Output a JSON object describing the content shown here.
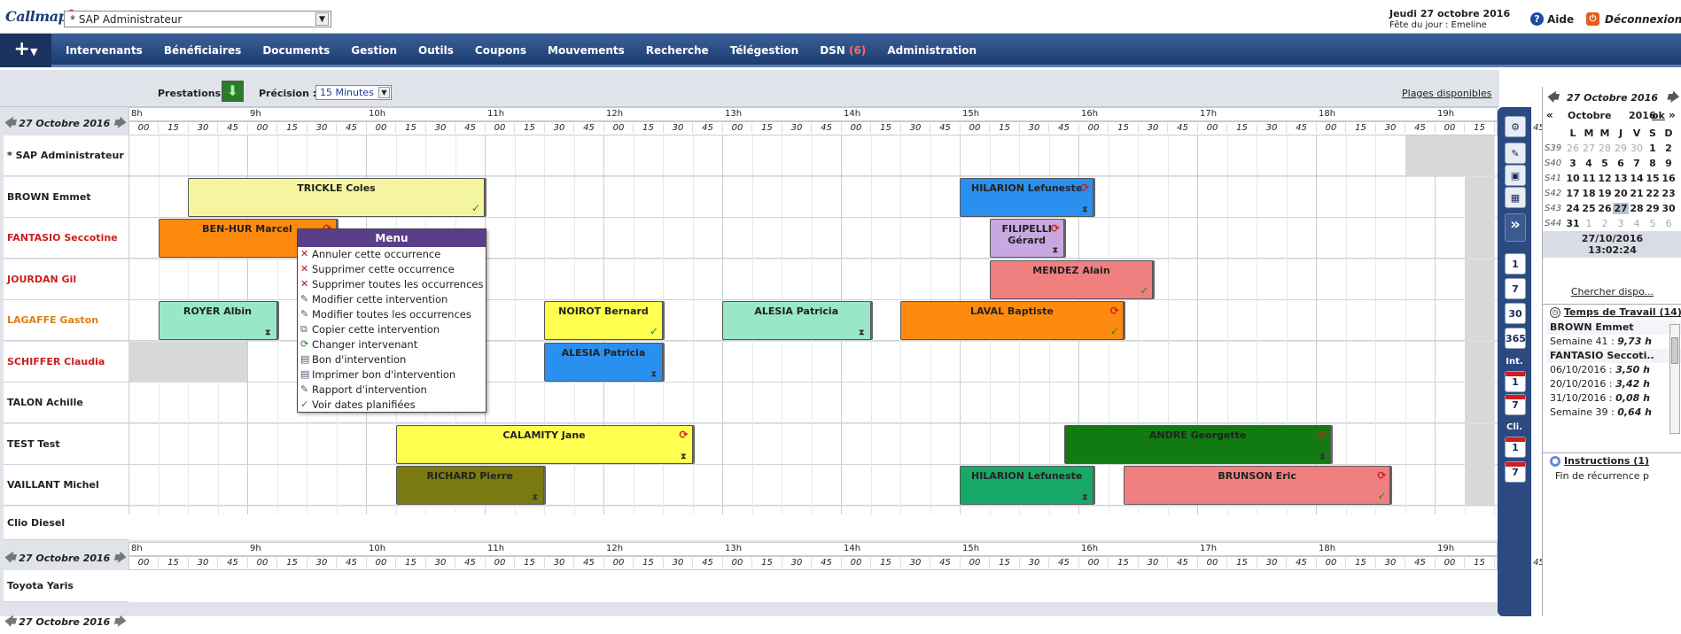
{
  "header": {
    "logo": "Callmap",
    "profile": "* SAP Administrateur",
    "date": "Jeudi 27 octobre 2016",
    "fete": "Fête du jour : Emeline",
    "help": "Aide",
    "logout": "Déconnexion"
  },
  "nav": {
    "items": [
      "Intervenants",
      "Bénéficiaires",
      "Documents",
      "Gestion",
      "Outils",
      "Coupons",
      "Mouvements",
      "Recherche",
      "Télégestion"
    ],
    "dsn_label": "DSN",
    "dsn_count": "(6)",
    "admin": "Administration"
  },
  "toolbar": {
    "prestations": "Prestations",
    "precision_label": "Précision :",
    "precision_value": "15 Minutes",
    "plages": "Plages disponibles"
  },
  "schedule": {
    "date": "27 Octobre 2016",
    "hours": [
      "8h",
      "9h",
      "10h",
      "11h",
      "12h",
      "13h",
      "14h",
      "15h",
      "16h",
      "17h",
      "18h",
      "19h"
    ],
    "minutes": [
      "00",
      "15",
      "30",
      "45"
    ],
    "last_hour_minutes": [
      "00",
      "15",
      "30",
      "45"
    ],
    "rows": [
      {
        "name": "* SAP Administrateur",
        "color": "#222"
      },
      {
        "name": "BROWN Emmet",
        "color": "#222"
      },
      {
        "name": "FANTASIO Seccotine",
        "color": "#d01d1d"
      },
      {
        "name": "JOURDAN Gil",
        "color": "#d01d1d"
      },
      {
        "name": "LAGAFFE Gaston",
        "color": "#e07d10"
      },
      {
        "name": "SCHIFFER Claudia",
        "color": "#d01d1d"
      },
      {
        "name": "TALON Achille",
        "color": "#222"
      },
      {
        "name": "TEST Test",
        "color": "#222"
      },
      {
        "name": "VAILLANT Michel",
        "color": "#222"
      }
    ],
    "extra_rows": [
      "Clio Diesel",
      "Toyota Yaris"
    ],
    "events": [
      {
        "row": 1,
        "label": "TRICKLE Coles",
        "start": 8.5,
        "end": 11,
        "bg": "#f5f5a0",
        "chk": true
      },
      {
        "row": 1,
        "label": "HILARION Lefuneste",
        "start": 15,
        "end": 16.13,
        "bg": "#2a90f0",
        "rec": true,
        "hg": true
      },
      {
        "row": 2,
        "label": "BEN-HUR Marcel",
        "start": 8.25,
        "end": 9.75,
        "bg": "#ff8a10",
        "rec": true
      },
      {
        "row": 2,
        "label": "FILIPELLI Gérard",
        "start": 15.25,
        "end": 15.88,
        "bg": "#c8a8e0",
        "rec": true,
        "hg": true
      },
      {
        "row": 3,
        "label": "MENDEZ Alain",
        "start": 15.25,
        "end": 16.63,
        "bg": "#f08080",
        "chk": true
      },
      {
        "row": 4,
        "label": "ROYER Albin",
        "start": 8.25,
        "end": 9.25,
        "bg": "#98e8c8",
        "hg": true
      },
      {
        "row": 4,
        "label": "NOIROT Bernard",
        "start": 11.5,
        "end": 12.5,
        "bg": "#ffff50",
        "chk": true
      },
      {
        "row": 4,
        "label": "ALESIA Patricia",
        "start": 13,
        "end": 14.25,
        "bg": "#98e8c8",
        "hg": true
      },
      {
        "row": 4,
        "label": "LAVAL Baptiste",
        "start": 14.5,
        "end": 16.38,
        "bg": "#ff8a10",
        "rec": true,
        "chk": true
      },
      {
        "row": 5,
        "label": "ALESIA Patricia",
        "start": 11.5,
        "end": 12.5,
        "bg": "#2a90f0",
        "hg": true
      },
      {
        "row": 7,
        "label": "CALAMITY Jane",
        "start": 10.25,
        "end": 12.75,
        "bg": "#ffff50",
        "rec": true,
        "hg": true
      },
      {
        "row": 7,
        "label": "ANDRE Georgette",
        "start": 15.88,
        "end": 18.13,
        "bg": "#127a12",
        "rec": true,
        "hg": true
      },
      {
        "row": 8,
        "label": "RICHARD Pierre",
        "start": 10.25,
        "end": 11.5,
        "bg": "#7a7a10",
        "hg": true
      },
      {
        "row": 8,
        "label": "HILARION Lefuneste",
        "start": 15,
        "end": 16.13,
        "bg": "#18a868",
        "hg": true
      },
      {
        "row": 8,
        "label": "BRUNSON Eric",
        "start": 16.38,
        "end": 18.63,
        "bg": "#f08080",
        "rec": true,
        "chk": true
      }
    ]
  },
  "context_menu": {
    "title": "Menu",
    "items": [
      {
        "label": "Annuler cette occurrence",
        "icon": "✕"
      },
      {
        "label": "Supprimer cette occurrence",
        "icon": "✕"
      },
      {
        "label": "Supprimer toutes les occurrences",
        "icon": "✕"
      },
      {
        "label": "Modifier cette intervention",
        "icon": "✎"
      },
      {
        "label": "Modifier toutes les occurrences",
        "icon": "✎"
      },
      {
        "label": "Copier cette intervention",
        "icon": "⧉"
      },
      {
        "label": "Changer intervenant",
        "icon": "⟳"
      },
      {
        "label": "Bon d'intervention",
        "icon": "▤"
      },
      {
        "label": "Imprimer bon d'intervention",
        "icon": "▤"
      },
      {
        "label": "Rapport d'intervention",
        "icon": "✎"
      },
      {
        "label": "Voir dates planifiées",
        "icon": "✓"
      }
    ]
  },
  "sidebar": {
    "buttons": [
      "1",
      "7",
      "30",
      "365"
    ],
    "int_label": "Int.",
    "cli_label": "Cli.",
    "cal1": "1",
    "cal7": "7"
  },
  "right": {
    "cal_title": "27 Octobre 2016",
    "month": "Octobre",
    "year": "2016",
    "ok": "ok",
    "weekdays": [
      "L",
      "M",
      "M",
      "J",
      "V",
      "S",
      "D"
    ],
    "weeks": [
      {
        "wk": "S39",
        "days": [
          [
            "26",
            1
          ],
          [
            "27",
            1
          ],
          [
            "28",
            1
          ],
          [
            "29",
            1
          ],
          [
            "30",
            1
          ],
          [
            "1",
            0
          ],
          [
            "2",
            0
          ]
        ]
      },
      {
        "wk": "S40",
        "days": [
          [
            "3",
            0
          ],
          [
            "4",
            0
          ],
          [
            "5",
            0
          ],
          [
            "6",
            0
          ],
          [
            "7",
            0
          ],
          [
            "8",
            0
          ],
          [
            "9",
            0
          ]
        ]
      },
      {
        "wk": "S41",
        "days": [
          [
            "10",
            0
          ],
          [
            "11",
            0
          ],
          [
            "12",
            0
          ],
          [
            "13",
            0
          ],
          [
            "14",
            0
          ],
          [
            "15",
            0
          ],
          [
            "16",
            0
          ]
        ]
      },
      {
        "wk": "S42",
        "days": [
          [
            "17",
            0
          ],
          [
            "18",
            0
          ],
          [
            "19",
            0
          ],
          [
            "20",
            0
          ],
          [
            "21",
            0
          ],
          [
            "22",
            0
          ],
          [
            "23",
            0
          ]
        ]
      },
      {
        "wk": "S43",
        "days": [
          [
            "24",
            0
          ],
          [
            "25",
            0
          ],
          [
            "26",
            0
          ],
          [
            "27",
            2
          ],
          [
            "28",
            0
          ],
          [
            "29",
            0
          ],
          [
            "30",
            0
          ]
        ]
      },
      {
        "wk": "S44",
        "days": [
          [
            "31",
            0
          ],
          [
            "1",
            1
          ],
          [
            "2",
            1
          ],
          [
            "3",
            1
          ],
          [
            "4",
            1
          ],
          [
            "5",
            1
          ],
          [
            "6",
            1
          ]
        ]
      }
    ],
    "now_date": "27/10/2016",
    "now_time": "13:02:24",
    "search": "Chercher dispo...",
    "work_title": "Temps de Travail (14)",
    "work": [
      {
        "type": "name",
        "text": "BROWN Emmet"
      },
      {
        "type": "val",
        "text": "Semaine 41 : ",
        "val": "9,73 h"
      },
      {
        "type": "name",
        "text": "FANTASIO Seccoti.."
      },
      {
        "type": "val",
        "text": "06/10/2016 : ",
        "val": "3,50 h"
      },
      {
        "type": "val",
        "text": "20/10/2016 : ",
        "val": "3,42 h"
      },
      {
        "type": "val",
        "text": "31/10/2016 : ",
        "val": "0,08 h"
      },
      {
        "type": "val",
        "text": "Semaine 39 : ",
        "val": "0,64 h"
      }
    ],
    "instr_title": "Instructions (1)",
    "instr_text": "Fin de récurrence p"
  }
}
